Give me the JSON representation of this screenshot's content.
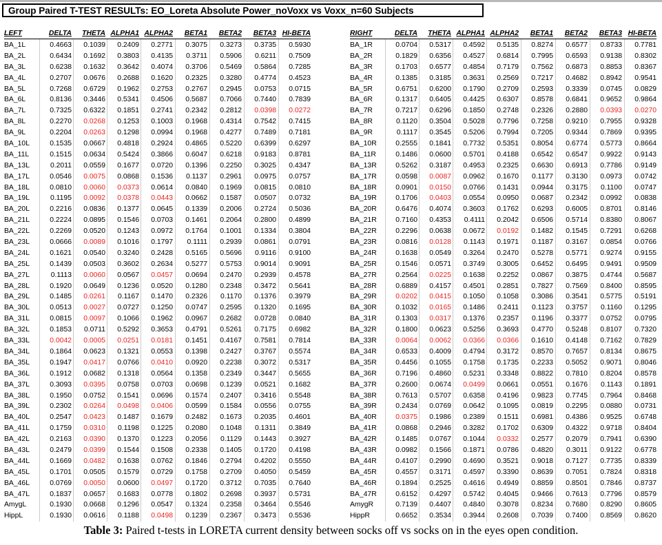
{
  "title": "Group Paired T-TEST RESULTs:  EO_Loreta Absolute Power_noVoxx vs Voxx_n=60 Subjects",
  "threshold": 0.05,
  "colors": {
    "significant": "#e8231f",
    "normal": "#000000",
    "grid": "#c9c9c9"
  },
  "left": {
    "headers": [
      "LEFT",
      "DELTA",
      "THETA",
      "ALPHA1",
      "ALPHA2",
      "BETA1",
      "BETA2",
      "BETA3",
      "HI-BETA"
    ],
    "rows": [
      [
        "BA_1L",
        "0.4663",
        "0.1039",
        "0.2409",
        "0.2771",
        "0.3075",
        "0.3273",
        "0.3735",
        "0.5930"
      ],
      [
        "BA_2L",
        "0.6434",
        "0.1692",
        "0.3803",
        "0.4135",
        "0.3711",
        "0.5906",
        "0.6211",
        "0.7509"
      ],
      [
        "BA_3L",
        "0.6238",
        "0.1632",
        "0.3642",
        "0.4074",
        "0.3706",
        "0.5469",
        "0.5864",
        "0.7285"
      ],
      [
        "BA_4L",
        "0.2707",
        "0.0676",
        "0.2688",
        "0.1620",
        "0.2325",
        "0.3280",
        "0.4774",
        "0.4523"
      ],
      [
        "BA_5L",
        "0.7268",
        "0.6729",
        "0.1962",
        "0.2753",
        "0.2767",
        "0.2945",
        "0.0753",
        "0.0715"
      ],
      [
        "BA_6L",
        "0.8136",
        "0.3446",
        "0.5341",
        "0.4506",
        "0.5687",
        "0.7066",
        "0.7440",
        "0.7839"
      ],
      [
        "BA_7L",
        "0.7325",
        "0.6322",
        "0.1851",
        "0.2741",
        "0.2342",
        "0.2812",
        "0.0398",
        "0.0272"
      ],
      [
        "BA_8L",
        "0.2270",
        "0.0268",
        "0.1253",
        "0.1003",
        "0.1968",
        "0.4314",
        "0.7542",
        "0.7415"
      ],
      [
        "BA_9L",
        "0.2204",
        "0.0263",
        "0.1298",
        "0.0994",
        "0.1968",
        "0.4277",
        "0.7489",
        "0.7181"
      ],
      [
        "BA_10L",
        "0.1535",
        "0.0667",
        "0.4818",
        "0.2924",
        "0.4865",
        "0.5220",
        "0.6399",
        "0.6297"
      ],
      [
        "BA_11L",
        "0.1515",
        "0.0634",
        "0.5424",
        "0.3866",
        "0.6047",
        "0.6218",
        "0.9183",
        "0.8781"
      ],
      [
        "BA_13L",
        "0.2011",
        "0.0559",
        "0.1677",
        "0.0720",
        "0.1396",
        "0.2250",
        "0.3025",
        "0.4347"
      ],
      [
        "BA_17L",
        "0.0546",
        "0.0075",
        "0.0868",
        "0.1536",
        "0.1137",
        "0.2961",
        "0.0975",
        "0.0757"
      ],
      [
        "BA_18L",
        "0.0810",
        "0.0060",
        "0.0373",
        "0.0614",
        "0.0840",
        "0.1969",
        "0.0815",
        "0.0810"
      ],
      [
        "BA_19L",
        "0.1195",
        "0.0092",
        "0.0378",
        "0.0443",
        "0.0662",
        "0.1587",
        "0.0507",
        "0.0732"
      ],
      [
        "BA_20L",
        "0.2216",
        "0.0836",
        "0.1377",
        "0.0645",
        "0.1339",
        "0.2006",
        "0.2724",
        "0.5036"
      ],
      [
        "BA_21L",
        "0.2224",
        "0.0895",
        "0.1546",
        "0.0703",
        "0.1461",
        "0.2064",
        "0.2800",
        "0.4899"
      ],
      [
        "BA_22L",
        "0.2269",
        "0.0520",
        "0.1243",
        "0.0972",
        "0.1764",
        "0.1001",
        "0.1334",
        "0.3804"
      ],
      [
        "BA_23L",
        "0.0666",
        "0.0089",
        "0.1016",
        "0.1797",
        "0.1111",
        "0.2939",
        "0.0861",
        "0.0791"
      ],
      [
        "BA_24L",
        "0.1621",
        "0.0540",
        "0.3240",
        "0.2428",
        "0.5165",
        "0.5696",
        "0.9116",
        "0.9100"
      ],
      [
        "BA_25L",
        "0.1439",
        "0.0503",
        "0.3602",
        "0.2634",
        "0.5277",
        "0.5753",
        "0.9014",
        "0.9091"
      ],
      [
        "BA_27L",
        "0.1113",
        "0.0060",
        "0.0567",
        "0.0457",
        "0.0694",
        "0.2470",
        "0.2939",
        "0.4578"
      ],
      [
        "BA_28L",
        "0.1920",
        "0.0649",
        "0.1236",
        "0.0520",
        "0.1280",
        "0.2348",
        "0.3472",
        "0.5641"
      ],
      [
        "BA_29L",
        "0.1485",
        "0.0261",
        "0.1167",
        "0.1470",
        "0.2326",
        "0.1170",
        "0.1376",
        "0.3979"
      ],
      [
        "BA_30L",
        "0.0513",
        "0.0027",
        "0.0727",
        "0.1250",
        "0.0747",
        "0.2595",
        "0.1320",
        "0.1695"
      ],
      [
        "BA_31L",
        "0.0815",
        "0.0097",
        "0.1066",
        "0.1962",
        "0.0967",
        "0.2682",
        "0.0728",
        "0.0840"
      ],
      [
        "BA_32L",
        "0.1853",
        "0.0711",
        "0.5292",
        "0.3653",
        "0.4791",
        "0.5261",
        "0.7175",
        "0.6982"
      ],
      [
        "BA_33L",
        "0.0042",
        "0.0005",
        "0.0251",
        "0.0181",
        "0.1451",
        "0.4167",
        "0.7581",
        "0.7814"
      ],
      [
        "BA_34L",
        "0.1864",
        "0.0623",
        "0.1321",
        "0.0553",
        "0.1398",
        "0.2427",
        "0.3767",
        "0.5574"
      ],
      [
        "BA_35L",
        "0.1947",
        "0.0417",
        "0.0766",
        "0.0410",
        "0.0920",
        "0.2238",
        "0.3072",
        "0.5317"
      ],
      [
        "BA_36L",
        "0.1912",
        "0.0682",
        "0.1318",
        "0.0564",
        "0.1358",
        "0.2349",
        "0.3447",
        "0.5655"
      ],
      [
        "BA_37L",
        "0.3093",
        "0.0395",
        "0.0758",
        "0.0703",
        "0.0698",
        "0.1239",
        "0.0521",
        "0.1682"
      ],
      [
        "BA_38L",
        "0.1950",
        "0.0752",
        "0.1541",
        "0.0696",
        "0.1574",
        "0.2407",
        "0.3416",
        "0.5548"
      ],
      [
        "BA_39L",
        "0.2302",
        "0.0264",
        "0.0498",
        "0.0406",
        "0.0599",
        "0.1584",
        "0.0556",
        "0.0755"
      ],
      [
        "BA_40L",
        "0.2547",
        "0.0423",
        "0.1487",
        "0.1679",
        "0.2482",
        "0.1673",
        "0.2035",
        "0.4601"
      ],
      [
        "BA_41L",
        "0.1759",
        "0.0310",
        "0.1198",
        "0.1225",
        "0.2080",
        "0.1048",
        "0.1311",
        "0.3849"
      ],
      [
        "BA_42L",
        "0.2163",
        "0.0390",
        "0.1370",
        "0.1223",
        "0.2056",
        "0.1129",
        "0.1443",
        "0.3927"
      ],
      [
        "BA_43L",
        "0.2479",
        "0.0399",
        "0.1544",
        "0.1508",
        "0.2338",
        "0.1405",
        "0.1720",
        "0.4198"
      ],
      [
        "BA_44L",
        "0.1669",
        "0.0482",
        "0.1638",
        "0.0762",
        "0.1846",
        "0.2794",
        "0.4202",
        "0.5550"
      ],
      [
        "BA_45L",
        "0.1701",
        "0.0505",
        "0.1579",
        "0.0729",
        "0.1758",
        "0.2709",
        "0.4050",
        "0.5459"
      ],
      [
        "BA_46L",
        "0.0769",
        "0.0050",
        "0.0600",
        "0.0497",
        "0.1720",
        "0.3712",
        "0.7035",
        "0.7640"
      ],
      [
        "BA_47L",
        "0.1837",
        "0.0657",
        "0.1683",
        "0.0778",
        "0.1802",
        "0.2698",
        "0.3937",
        "0.5731"
      ],
      [
        "AmygL",
        "0.1930",
        "0.0668",
        "0.1296",
        "0.0547",
        "0.1324",
        "0.2358",
        "0.3464",
        "0.5546"
      ],
      [
        "HippL",
        "0.1930",
        "0.0616",
        "0.1188",
        "0.0498",
        "0.1239",
        "0.2367",
        "0.3473",
        "0.5536"
      ]
    ]
  },
  "right": {
    "headers": [
      "RIGHT",
      "DELTA",
      "THETA",
      "ALPHA1",
      "ALPHA2",
      "BETA1",
      "BETA2",
      "BETA3",
      "HI-BETA"
    ],
    "rows": [
      [
        "BA_1R",
        "0.0704",
        "0.5317",
        "0.4592",
        "0.5135",
        "0.8274",
        "0.6577",
        "0.8733",
        "0.7781"
      ],
      [
        "BA_2R",
        "0.1829",
        "0.6356",
        "0.4527",
        "0.6814",
        "0.7995",
        "0.6593",
        "0.9138",
        "0.8302"
      ],
      [
        "BA_3R",
        "0.1703",
        "0.6577",
        "0.4854",
        "0.7179",
        "0.7562",
        "0.6873",
        "0.8853",
        "0.8367"
      ],
      [
        "BA_4R",
        "0.1385",
        "0.3185",
        "0.3631",
        "0.2569",
        "0.7217",
        "0.4682",
        "0.8942",
        "0.9541"
      ],
      [
        "BA_5R",
        "0.6751",
        "0.6200",
        "0.1790",
        "0.2709",
        "0.2593",
        "0.3339",
        "0.0745",
        "0.0829"
      ],
      [
        "BA_6R",
        "0.1317",
        "0.6405",
        "0.4425",
        "0.6307",
        "0.8578",
        "0.6841",
        "0.9652",
        "0.9864"
      ],
      [
        "BA_7R",
        "0.7217",
        "0.6296",
        "0.1850",
        "0.2748",
        "0.2326",
        "0.2880",
        "0.0393",
        "0.0270"
      ],
      [
        "BA_8R",
        "0.1120",
        "0.3504",
        "0.5028",
        "0.7796",
        "0.7258",
        "0.9210",
        "0.7955",
        "0.9328"
      ],
      [
        "BA_9R",
        "0.1117",
        "0.3545",
        "0.5206",
        "0.7994",
        "0.7205",
        "0.9344",
        "0.7869",
        "0.9395"
      ],
      [
        "BA_10R",
        "0.2555",
        "0.1841",
        "0.7732",
        "0.5351",
        "0.8054",
        "0.6774",
        "0.5773",
        "0.8664"
      ],
      [
        "BA_11R",
        "0.1486",
        "0.0600",
        "0.5701",
        "0.4188",
        "0.6542",
        "0.6547",
        "0.9922",
        "0.9143"
      ],
      [
        "BA_13R",
        "0.5262",
        "0.3187",
        "0.4953",
        "0.2325",
        "0.6630",
        "0.6913",
        "0.7786",
        "0.9149"
      ],
      [
        "BA_17R",
        "0.0598",
        "0.0087",
        "0.0962",
        "0.1670",
        "0.1177",
        "0.3130",
        "0.0973",
        "0.0742"
      ],
      [
        "BA_18R",
        "0.0901",
        "0.0150",
        "0.0766",
        "0.1431",
        "0.0944",
        "0.3175",
        "0.1100",
        "0.0747"
      ],
      [
        "BA_19R",
        "0.1706",
        "0.0403",
        "0.0554",
        "0.0950",
        "0.0687",
        "0.2342",
        "0.0992",
        "0.0838"
      ],
      [
        "BA_20R",
        "0.6476",
        "0.4074",
        "0.3603",
        "0.1762",
        "0.6293",
        "0.6005",
        "0.8701",
        "0.8146"
      ],
      [
        "BA_21R",
        "0.7160",
        "0.4353",
        "0.4111",
        "0.2042",
        "0.6506",
        "0.5714",
        "0.8380",
        "0.8067"
      ],
      [
        "BA_22R",
        "0.2296",
        "0.0638",
        "0.0672",
        "0.0192",
        "0.1482",
        "0.1545",
        "0.7291",
        "0.6268"
      ],
      [
        "BA_23R",
        "0.0816",
        "0.0128",
        "0.1143",
        "0.1971",
        "0.1187",
        "0.3167",
        "0.0854",
        "0.0766"
      ],
      [
        "BA_24R",
        "0.1638",
        "0.0549",
        "0.3264",
        "0.2470",
        "0.5278",
        "0.5771",
        "0.9274",
        "0.9155"
      ],
      [
        "BA_25R",
        "0.1546",
        "0.0571",
        "0.3749",
        "0.3005",
        "0.6452",
        "0.6495",
        "0.9491",
        "0.9509"
      ],
      [
        "BA_27R",
        "0.2564",
        "0.0225",
        "0.1638",
        "0.2252",
        "0.0867",
        "0.3875",
        "0.4744",
        "0.5687"
      ],
      [
        "BA_28R",
        "0.6889",
        "0.4157",
        "0.4501",
        "0.2851",
        "0.7827",
        "0.7569",
        "0.8400",
        "0.8595"
      ],
      [
        "BA_29R",
        "0.0202",
        "0.0415",
        "0.1050",
        "0.1058",
        "0.3086",
        "0.3541",
        "0.5775",
        "0.5191"
      ],
      [
        "BA_30R",
        "0.1032",
        "0.0165",
        "0.1486",
        "0.2411",
        "0.1123",
        "0.3757",
        "0.1160",
        "0.1295"
      ],
      [
        "BA_31R",
        "0.1303",
        "0.0317",
        "0.1376",
        "0.2357",
        "0.1196",
        "0.3377",
        "0.0752",
        "0.0795"
      ],
      [
        "BA_32R",
        "0.1800",
        "0.0623",
        "0.5256",
        "0.3693",
        "0.4770",
        "0.5248",
        "0.8107",
        "0.7320"
      ],
      [
        "BA_33R",
        "0.0064",
        "0.0062",
        "0.0366",
        "0.0366",
        "0.1610",
        "0.4148",
        "0.7162",
        "0.7829"
      ],
      [
        "BA_34R",
        "0.6533",
        "0.4009",
        "0.4794",
        "0.3172",
        "0.8570",
        "0.7657",
        "0.8134",
        "0.8675"
      ],
      [
        "BA_35R",
        "0.4456",
        "0.1055",
        "0.1758",
        "0.1735",
        "0.2233",
        "0.5052",
        "0.9071",
        "0.8046"
      ],
      [
        "BA_36R",
        "0.7196",
        "0.4860",
        "0.5231",
        "0.3348",
        "0.8822",
        "0.7810",
        "0.8204",
        "0.8578"
      ],
      [
        "BA_37R",
        "0.2600",
        "0.0674",
        "0.0499",
        "0.0661",
        "0.0551",
        "0.1676",
        "0.1143",
        "0.1891"
      ],
      [
        "BA_38R",
        "0.7613",
        "0.5707",
        "0.6358",
        "0.4196",
        "0.9823",
        "0.7745",
        "0.7964",
        "0.8468"
      ],
      [
        "BA_39R",
        "0.2434",
        "0.0769",
        "0.0642",
        "0.1095",
        "0.0819",
        "0.2295",
        "0.0880",
        "0.0731"
      ],
      [
        "BA_40R",
        "0.0375",
        "0.1986",
        "0.2389",
        "0.1511",
        "0.6981",
        "0.4386",
        "0.9525",
        "0.6748"
      ],
      [
        "BA_41R",
        "0.0868",
        "0.2946",
        "0.3282",
        "0.1702",
        "0.6309",
        "0.4322",
        "0.9718",
        "0.8404"
      ],
      [
        "BA_42R",
        "0.1485",
        "0.0767",
        "0.1044",
        "0.0332",
        "0.2577",
        "0.2079",
        "0.7941",
        "0.6390"
      ],
      [
        "BA_43R",
        "0.0982",
        "0.1566",
        "0.1871",
        "0.0786",
        "0.4820",
        "0.3011",
        "0.9122",
        "0.6778"
      ],
      [
        "BA_44R",
        "0.4107",
        "0.2990",
        "0.4690",
        "0.3521",
        "0.9018",
        "0.7127",
        "0.7735",
        "0.8339"
      ],
      [
        "BA_45R",
        "0.4557",
        "0.3171",
        "0.4597",
        "0.3390",
        "0.8639",
        "0.7051",
        "0.7824",
        "0.8318"
      ],
      [
        "BA_46R",
        "0.1894",
        "0.2525",
        "0.4616",
        "0.4949",
        "0.8859",
        "0.8501",
        "0.7846",
        "0.8737"
      ],
      [
        "BA_47R",
        "0.6152",
        "0.4297",
        "0.5742",
        "0.4045",
        "0.9466",
        "0.7613",
        "0.7796",
        "0.8579"
      ],
      [
        "AmygR",
        "0.7139",
        "0.4407",
        "0.4840",
        "0.3078",
        "0.8234",
        "0.7680",
        "0.8290",
        "0.8605"
      ],
      [
        "HippR",
        "0.6652",
        "0.3534",
        "0.3944",
        "0.2608",
        "0.7039",
        "0.7400",
        "0.8569",
        "0.8620"
      ]
    ]
  },
  "caption": {
    "label": "Table 3:",
    "text": " Paired t-tests in LORETA current density between socks off vs socks on in the eyes open condition."
  }
}
